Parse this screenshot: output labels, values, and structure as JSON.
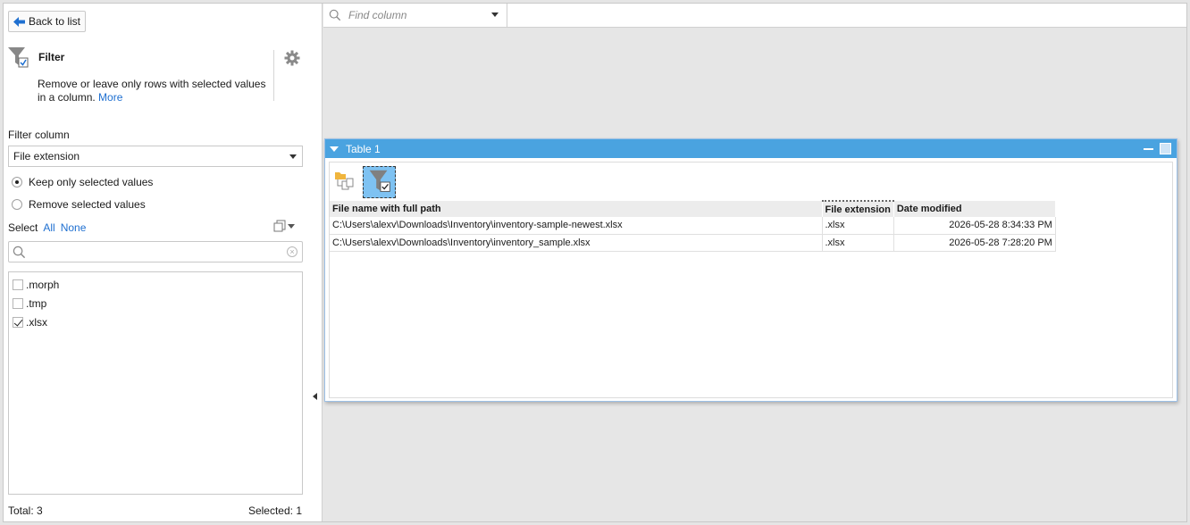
{
  "sidebar": {
    "back_label": "Back to list",
    "filter_title": "Filter",
    "filter_desc": "Remove or leave only rows with selected values in a column.",
    "more_link": "More",
    "filter_column_label": "Filter column",
    "filter_column_value": "File extension",
    "radio_keep": "Keep only selected values",
    "radio_remove": "Remove selected values",
    "select_label": "Select",
    "select_all": "All",
    "select_none": "None",
    "search_placeholder": "",
    "values": [
      {
        "label": ".morph",
        "checked": false
      },
      {
        "label": ".tmp",
        "checked": false
      },
      {
        "label": ".xlsx",
        "checked": true
      }
    ],
    "total": "Total: 3",
    "selected": "Selected: 1"
  },
  "find_column": {
    "placeholder": "Find column"
  },
  "table_window": {
    "title": "Table 1",
    "columns": [
      "File name with full path",
      "File extension",
      "Date modified"
    ],
    "rows": [
      [
        "C:\\Users\\alexv\\Downloads\\Inventory\\inventory-sample-newest.xlsx",
        ".xlsx",
        "2026-05-28 8:34:33 PM"
      ],
      [
        "C:\\Users\\alexv\\Downloads\\Inventory\\inventory_sample.xlsx",
        ".xlsx",
        "2026-05-28 7:28:20 PM"
      ]
    ]
  },
  "colors": {
    "accent": "#4aa3e0",
    "link": "#1e6fd0",
    "active_tool": "#7ec2f2"
  }
}
